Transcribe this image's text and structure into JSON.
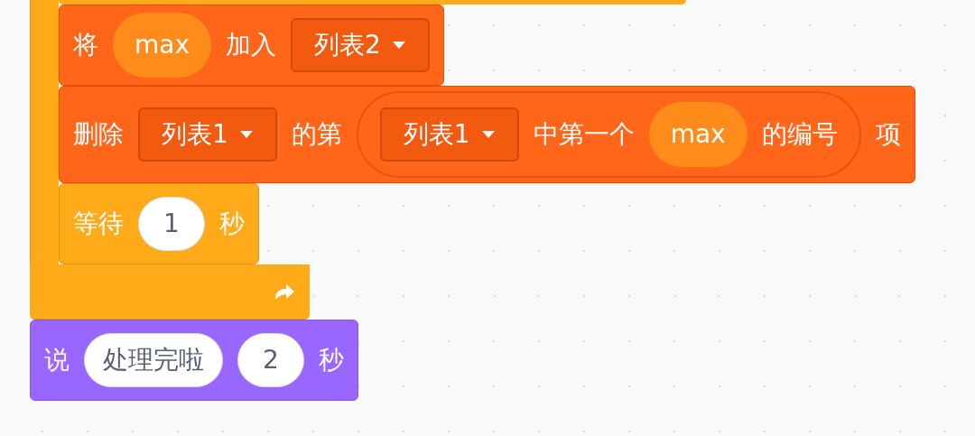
{
  "loop": {
    "blocks": [
      {
        "kind": "list",
        "parts": [
          {
            "kind": "label",
            "text": "将"
          },
          {
            "kind": "variable",
            "text": "max"
          },
          {
            "kind": "label",
            "text": "加入"
          },
          {
            "kind": "dropdown",
            "text": "列表2"
          }
        ]
      },
      {
        "kind": "list",
        "parts": [
          {
            "kind": "label",
            "text": "删除"
          },
          {
            "kind": "dropdown",
            "text": "列表1"
          },
          {
            "kind": "label",
            "text": "的第"
          },
          {
            "kind": "reporter",
            "parts": [
              {
                "kind": "dropdown",
                "text": "列表1"
              },
              {
                "kind": "label",
                "text": "中第一个"
              },
              {
                "kind": "variable",
                "text": "max"
              },
              {
                "kind": "label",
                "text": "的编号"
              }
            ]
          },
          {
            "kind": "label",
            "text": "项"
          }
        ]
      },
      {
        "kind": "control",
        "parts": [
          {
            "kind": "label",
            "text": "等待"
          },
          {
            "kind": "number",
            "text": "1"
          },
          {
            "kind": "label",
            "text": "秒"
          }
        ]
      }
    ]
  },
  "after": [
    {
      "kind": "looks",
      "parts": [
        {
          "kind": "label",
          "text": "说"
        },
        {
          "kind": "text",
          "text": "处理完啦"
        },
        {
          "kind": "number",
          "text": "2"
        },
        {
          "kind": "label",
          "text": "秒"
        }
      ]
    }
  ]
}
